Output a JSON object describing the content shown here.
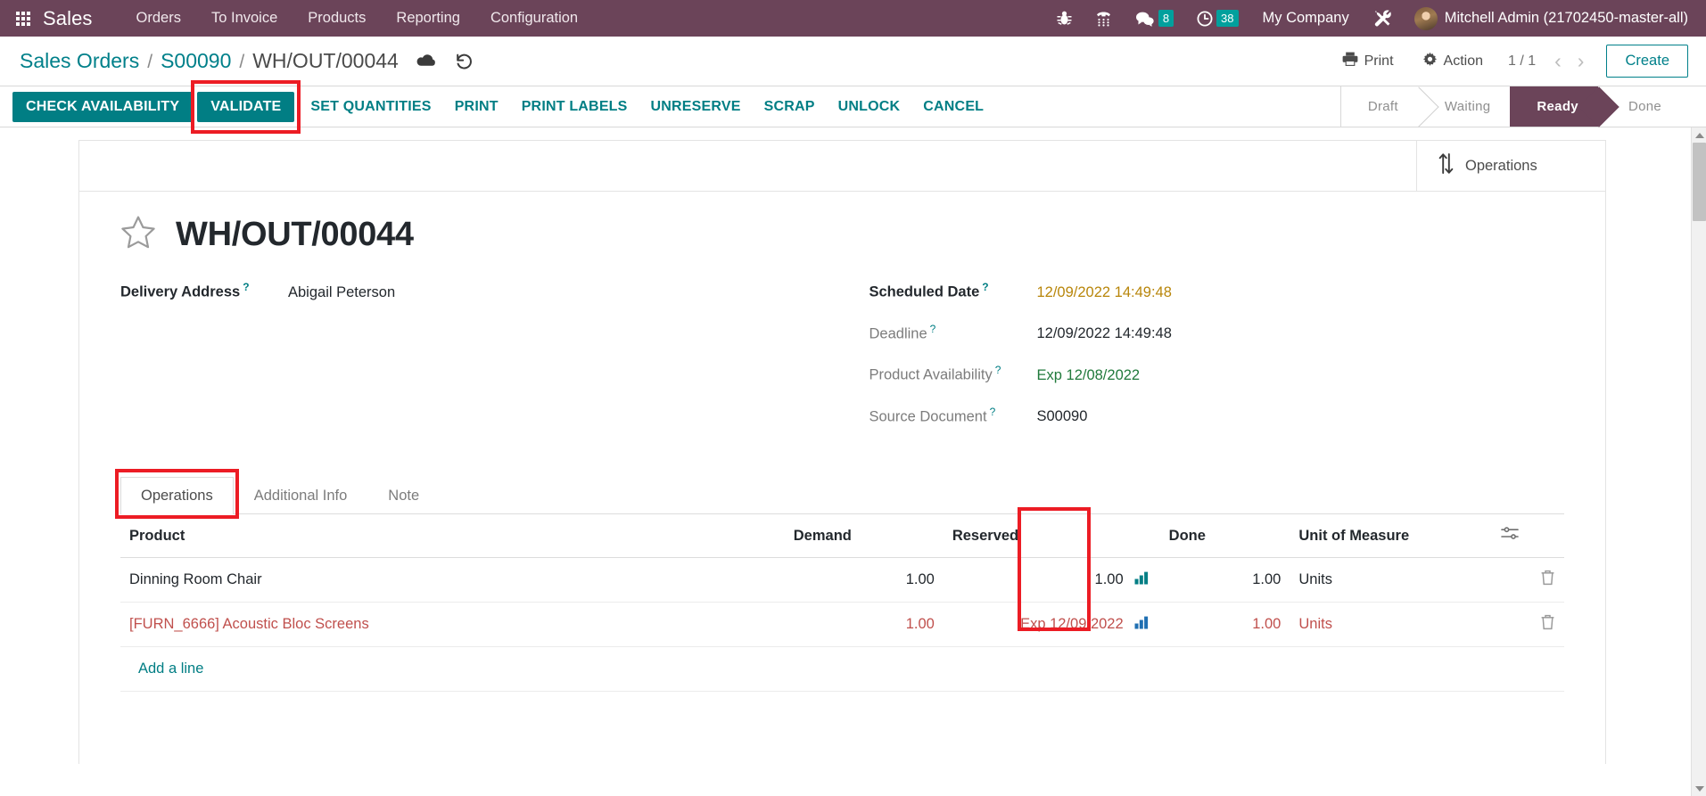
{
  "navbar": {
    "apps_icon": "apps-grid-icon",
    "brand": "Sales",
    "menu": [
      {
        "label": "Orders"
      },
      {
        "label": "To Invoice"
      },
      {
        "label": "Products"
      },
      {
        "label": "Reporting"
      },
      {
        "label": "Configuration"
      }
    ],
    "icons": [
      {
        "name": "bug-icon"
      },
      {
        "name": "phone-dialpad-icon"
      },
      {
        "name": "messages-icon",
        "badge": "8"
      },
      {
        "name": "activities-clock-icon",
        "badge": "38"
      }
    ],
    "company": "My Company",
    "tools_icon": "tools-icon",
    "user": "Mitchell Admin (21702450-master-all)",
    "bg_color": "#6b4459"
  },
  "breadcrumb": {
    "root": "Sales Orders",
    "parent": "S00090",
    "current": "WH/OUT/00044",
    "sep": "/",
    "save_icon": "cloud-save-icon",
    "discard_icon": "discard-undo-icon"
  },
  "controls": {
    "print": "Print",
    "action": "Action",
    "pager": "1 / 1",
    "prev_icon": "chevron-left-icon",
    "next_icon": "chevron-right-icon",
    "create": "Create"
  },
  "action_buttons": [
    {
      "label": "Check Availability",
      "style": "primary"
    },
    {
      "label": "Validate",
      "style": "primary",
      "highlighted": true
    },
    {
      "label": "Set Quantities",
      "style": "link"
    },
    {
      "label": "Print",
      "style": "link"
    },
    {
      "label": "Print Labels",
      "style": "link"
    },
    {
      "label": "Unreserve",
      "style": "link"
    },
    {
      "label": "Scrap",
      "style": "link"
    },
    {
      "label": "Unlock",
      "style": "link"
    },
    {
      "label": "Cancel",
      "style": "link"
    }
  ],
  "statusbar": {
    "stages": [
      {
        "label": "Draft",
        "active": false
      },
      {
        "label": "Waiting",
        "active": false
      },
      {
        "label": "Ready",
        "active": true
      },
      {
        "label": "Done",
        "active": false
      }
    ],
    "active_color": "#6b4459"
  },
  "smart_button": {
    "icon": "exchange-vertical-arrows-icon",
    "label": "Operations"
  },
  "record": {
    "favorite_icon": "star-outline-icon",
    "title": "WH/OUT/00044",
    "left_fields": [
      {
        "label": "Delivery Address",
        "value": "Abigail Peterson",
        "tooltip": "?",
        "strong": true,
        "color": "normal"
      }
    ],
    "right_fields": [
      {
        "label": "Scheduled Date",
        "value": "12/09/2022 14:49:48",
        "tooltip": "?",
        "strong": true,
        "color": "orange"
      },
      {
        "label": "Deadline",
        "value": "12/09/2022 14:49:48",
        "tooltip": "?",
        "strong": false,
        "color": "normal"
      },
      {
        "label": "Product Availability",
        "value": "Exp 12/08/2022",
        "tooltip": "?",
        "strong": false,
        "color": "green"
      },
      {
        "label": "Source Document",
        "value": "S00090",
        "tooltip": "?",
        "strong": false,
        "color": "normal"
      }
    ]
  },
  "notebook": {
    "tabs": [
      {
        "label": "Operations",
        "active": true,
        "highlighted": true
      },
      {
        "label": "Additional Info",
        "active": false
      },
      {
        "label": "Note",
        "active": false
      }
    ],
    "table": {
      "columns": [
        "Product",
        "Demand",
        "Reserved",
        "Done",
        "Unit of Measure"
      ],
      "optional_columns_icon": "column-options-icon",
      "rows": [
        {
          "product": "Dinning Room Chair",
          "demand": "1.00",
          "reserved": "1.00",
          "done": "1.00",
          "uom": "Units",
          "danger": false,
          "detail_icon": "detailed-operations-icon",
          "delete_icon": "trash-icon"
        },
        {
          "product": "[FURN_6666] Acoustic Bloc Screens",
          "demand": "1.00",
          "reserved": "Exp 12/09/2022",
          "done": "1.00",
          "uom": "Units",
          "danger": true,
          "detail_icon": "detailed-operations-icon",
          "delete_icon": "trash-icon"
        }
      ],
      "add_line": "Add a line"
    }
  },
  "annotations": {
    "color": "#ec1c24",
    "boxes": [
      "validate-button",
      "operations-tab",
      "done-column"
    ]
  },
  "scrollbar": {
    "up_icon": "scroll-up-arrow-icon",
    "down_icon": "scroll-down-arrow-icon"
  }
}
